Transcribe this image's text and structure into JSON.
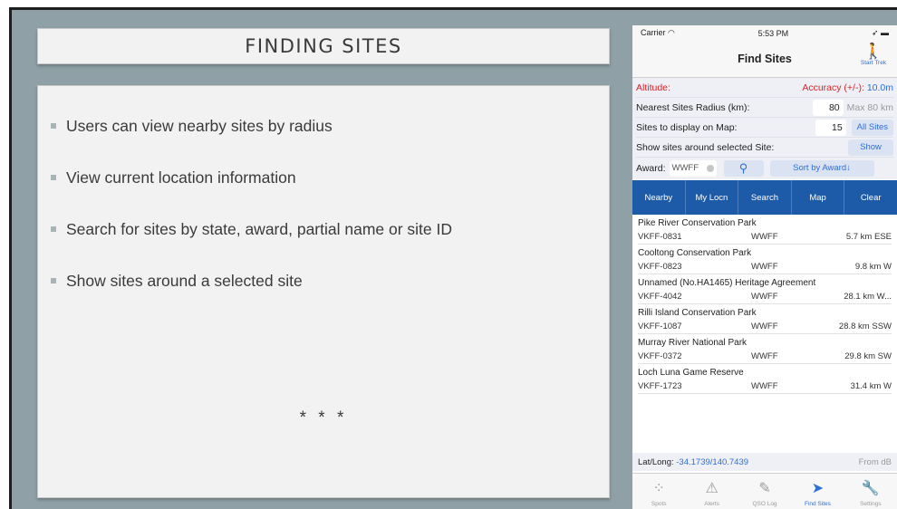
{
  "slide": {
    "title": "FINDING SITES",
    "bullets": [
      "Users can view nearby sites by radius",
      "View current location information",
      "Search for sites by state, award, partial name or site ID",
      "Show sites around a selected site"
    ],
    "stars": "* * *"
  },
  "phone": {
    "status": {
      "carrier": "Carrier",
      "time": "5:53 PM"
    },
    "nav_title": "Find Sites",
    "start_trek": "Start Trek",
    "altitude_label": "Altitude:",
    "accuracy_label": "Accuracy (+/-):",
    "accuracy_value": "10.0m",
    "radius_label": "Nearest Sites Radius (km):",
    "radius_value": "80",
    "radius_max": "Max 80 km",
    "display_label": "Sites to display on Map:",
    "display_value": "15",
    "all_sites_btn": "All Sites",
    "around_label": "Show sites around selected Site:",
    "show_btn": "Show",
    "award_label": "Award:",
    "award_value": "WWFF",
    "sort_btn": "Sort by Award↓",
    "tabs": [
      "Nearby",
      "My Locn",
      "Search",
      "Map",
      "Clear"
    ],
    "sites": [
      {
        "name": "Pike River Conservation Park",
        "id": "VKFF-0831",
        "award": "WWFF",
        "dist": "5.7 km ESE"
      },
      {
        "name": "Cooltong Conservation Park",
        "id": "VKFF-0823",
        "award": "WWFF",
        "dist": "9.8 km W"
      },
      {
        "name": "Unnamed (No.HA1465) Heritage Agreement",
        "id": "VKFF-4042",
        "award": "WWFF",
        "dist": "28.1 km W..."
      },
      {
        "name": "Rilli Island Conservation Park",
        "id": "VKFF-1087",
        "award": "WWFF",
        "dist": "28.8 km SSW"
      },
      {
        "name": "Murray River National Park",
        "id": "VKFF-0372",
        "award": "WWFF",
        "dist": "29.8 km SW"
      },
      {
        "name": "Loch Luna Game Reserve",
        "id": "VKFF-1723",
        "award": "WWFF",
        "dist": "31.4 km W"
      }
    ],
    "latlong_label": "Lat/Long:",
    "latlong_value": "-34.1739/140.7439",
    "from_db": "From dB",
    "bottom_tabs": [
      {
        "label": "Spots",
        "icon": "spots-icon"
      },
      {
        "label": "Alerts",
        "icon": "alert-icon"
      },
      {
        "label": "QSO Log",
        "icon": "log-icon"
      },
      {
        "label": "Find Sites",
        "icon": "location-arrow-icon"
      },
      {
        "label": "Settings",
        "icon": "wrench-icon"
      }
    ]
  }
}
